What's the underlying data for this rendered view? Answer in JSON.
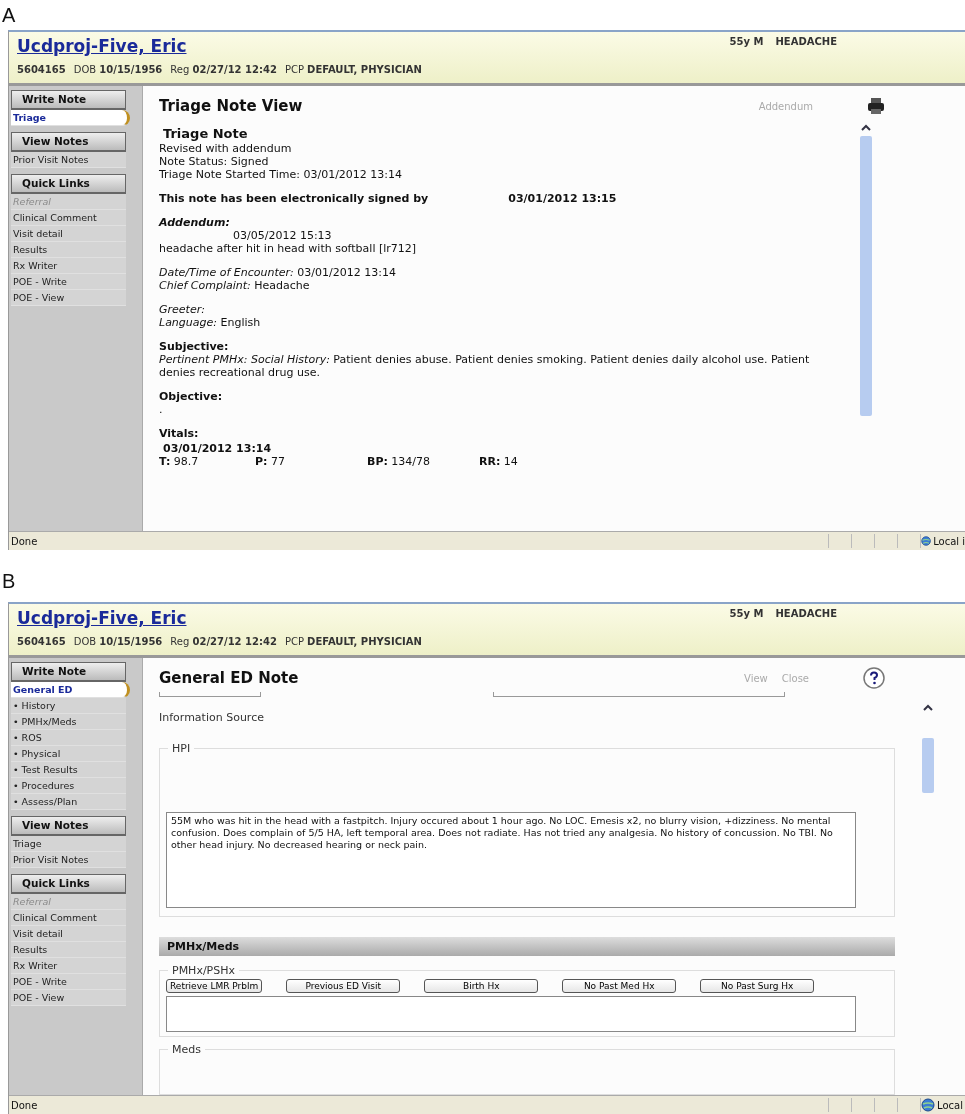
{
  "panels": [
    {
      "label": "A",
      "header": {
        "name": "Ucdproj-Five, Eric",
        "age_sex": "55y M",
        "complaint": "HEADACHE",
        "info": [
          "**5604165**",
          "DOB **10/15/1956**",
          "Reg **02/27/12 12:42**",
          "PCP **DEFAULT, PHYSICIAN**"
        ]
      },
      "sidebar": [
        {
          "title": "Write Note",
          "items": [
            {
              "label": "Triage",
              "selected": true,
              "disabled": false
            }
          ]
        },
        {
          "title": "View Notes",
          "items": [
            {
              "label": "Prior Visit Notes",
              "selected": false,
              "disabled": false
            }
          ]
        },
        {
          "title": "Quick Links",
          "items": [
            {
              "label": "Referral",
              "selected": false,
              "disabled": true
            },
            {
              "label": "Clinical Comment",
              "selected": false,
              "disabled": false
            },
            {
              "label": "Visit detail",
              "selected": false,
              "disabled": false
            },
            {
              "label": "Results",
              "selected": false,
              "disabled": false
            },
            {
              "label": "Rx Writer",
              "selected": false,
              "disabled": false
            },
            {
              "label": "POE - Write",
              "selected": false,
              "disabled": false
            },
            {
              "label": "POE - View",
              "selected": false,
              "disabled": false
            }
          ]
        }
      ],
      "content": {
        "title": "Triage Note View",
        "actions": [
          "Addendum"
        ],
        "tool": {
          "kind": "print"
        },
        "blocks": [
          {
            "kind": "heading",
            "text": "Triage Note"
          },
          {
            "kind": "lines",
            "lines": [
              "Revised with addendum",
              "Note Status: Signed",
              "Triage Note Started Time: 03/01/2012 13:14"
            ]
          },
          {
            "kind": "signed",
            "text": "This note has been electronically signed by",
            "time": "03/01/2012 13:15"
          },
          {
            "kind": "addendum",
            "title": "Addendum:",
            "time": "03/05/2012 15:13",
            "text": "headache after hit in head with softball [lr712]"
          },
          {
            "kind": "lines",
            "lines": [
              "*Date/Time of Encounter:* 03/01/2012 13:14",
              "*Chief Complaint:* Headache"
            ]
          },
          {
            "kind": "lines",
            "lines": [
              "*Greeter:*",
              "*Language:* English"
            ]
          },
          {
            "kind": "section",
            "title": "Subjective:",
            "lines": [
              "*Pertinent PMHx: Social History:* Patient denies abuse. Patient denies smoking. Patient denies daily alcohol use. Patient denies recreational drug use."
            ]
          },
          {
            "kind": "section",
            "title": "Objective:",
            "lines": [
              "."
            ]
          },
          {
            "kind": "vitals",
            "title": "Vitals:",
            "time": "03/01/2012 13:14",
            "readings": [
              "**T:** 98.7",
              "**P:** 77",
              "**BP:** 134/78",
              "**RR:** 14"
            ]
          }
        ]
      },
      "status_bar": {
        "text": "Done",
        "zone": "Local i"
      }
    },
    {
      "label": "B",
      "header": {
        "name": "Ucdproj-Five, Eric",
        "age_sex": "55y M",
        "complaint": "HEADACHE",
        "info": [
          "**5604165**",
          "DOB **10/15/1956**",
          "Reg **02/27/12 12:42**",
          "PCP **DEFAULT, PHYSICIAN**"
        ]
      },
      "sidebar": [
        {
          "title": "Write Note",
          "items": [
            {
              "label": "General ED",
              "selected": true,
              "disabled": false
            },
            {
              "label": "• History",
              "selected": false,
              "disabled": false
            },
            {
              "label": "• PMHx/Meds",
              "selected": false,
              "disabled": false
            },
            {
              "label": "• ROS",
              "selected": false,
              "disabled": false
            },
            {
              "label": "• Physical",
              "selected": false,
              "disabled": false
            },
            {
              "label": "• Test Results",
              "selected": false,
              "disabled": false
            },
            {
              "label": "• Procedures",
              "selected": false,
              "disabled": false
            },
            {
              "label": "• Assess/Plan",
              "selected": false,
              "disabled": false
            }
          ]
        },
        {
          "title": "View Notes",
          "items": [
            {
              "label": "Triage",
              "selected": false,
              "disabled": false
            },
            {
              "label": "Prior Visit Notes",
              "selected": false,
              "disabled": false
            }
          ]
        },
        {
          "title": "Quick Links",
          "items": [
            {
              "label": "Referral",
              "selected": false,
              "disabled": true
            },
            {
              "label": "Clinical Comment",
              "selected": false,
              "disabled": false
            },
            {
              "label": "Visit detail",
              "selected": false,
              "disabled": false
            },
            {
              "label": "Results",
              "selected": false,
              "disabled": false
            },
            {
              "label": "Rx Writer",
              "selected": false,
              "disabled": false
            },
            {
              "label": "POE - Write",
              "selected": false,
              "disabled": false
            },
            {
              "label": "POE - View",
              "selected": false,
              "disabled": false
            }
          ]
        }
      ],
      "content": {
        "title": "General ED Note",
        "actions": [
          "View",
          "Close"
        ],
        "tool": {
          "kind": "help"
        },
        "blocks": [
          {
            "kind": "clipped_inputs"
          },
          {
            "kind": "label",
            "text": "Information Source"
          },
          {
            "kind": "text_group",
            "legend": "HPI",
            "value": "55M who was hit in the head with a fastpitch.  Injury occured about 1 hour ago. No LOC.  Emesis x2, no blurry vision, +dizziness. No mental confusion. Does complain of 5/5 HA, left temporal area.  Does not radiate. Has not tried any analgesia.  No history of concussion. No TBI.  No other head injury. No decreased hearing or neck pain."
          },
          {
            "kind": "bar",
            "text": "PMHx/Meds"
          },
          {
            "kind": "button_group",
            "legend": "PMHx/PSHx",
            "buttons": [
              "Retrieve LMR Prblm",
              "Previous ED Visit",
              "Birth Hx",
              "No Past Med Hx",
              "No Past Surg Hx"
            ]
          },
          {
            "kind": "clipped_group",
            "legend": "Meds"
          }
        ]
      },
      "status_bar": {
        "text": "Done",
        "zone": "Local"
      }
    }
  ]
}
